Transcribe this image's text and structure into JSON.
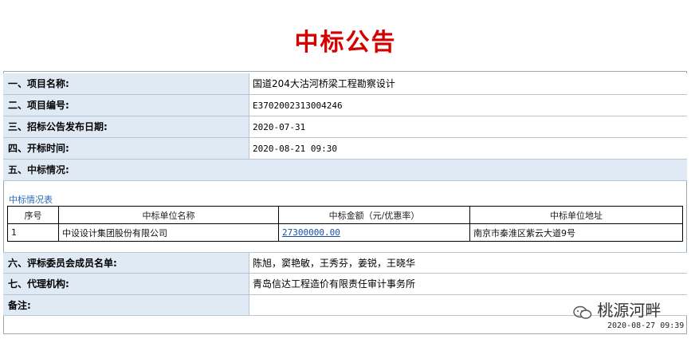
{
  "title": "中标公告",
  "rows": [
    {
      "label": "一、项目名称:",
      "value": "国道204大沽河桥梁工程勘察设计"
    },
    {
      "label": "二、项目编号:",
      "value": "E3702002313004246"
    },
    {
      "label": "三、招标公告发布日期:",
      "value": "2020-07-31"
    },
    {
      "label": "四、开标时间:",
      "value": "2020-08-21 09:30"
    }
  ],
  "section5": {
    "label": "五、中标情况:"
  },
  "winning_table": {
    "caption": "中标情况表",
    "headers": [
      "序号",
      "中标单位名称",
      "中标金额（元/优惠率）",
      "中标单位地址"
    ],
    "row": {
      "index": "1",
      "name": "中设设计集团股份有限公司",
      "amount": "27300000.00",
      "address": "南京市秦淮区紫云大道9号"
    }
  },
  "rows2": [
    {
      "label": "六、评标委员会成员名单:",
      "value": "陈旭，窦艳敏，王秀芬，姜锐，王晓华"
    },
    {
      "label": "七、代理机构:",
      "value": "青岛信达工程造价有限责任审计事务所"
    },
    {
      "label": "备注:",
      "value": ""
    }
  ],
  "watermark": {
    "text": "桃源河畔",
    "icon": "wechat-icon"
  },
  "timestamp": "2020-08-27 09:39"
}
